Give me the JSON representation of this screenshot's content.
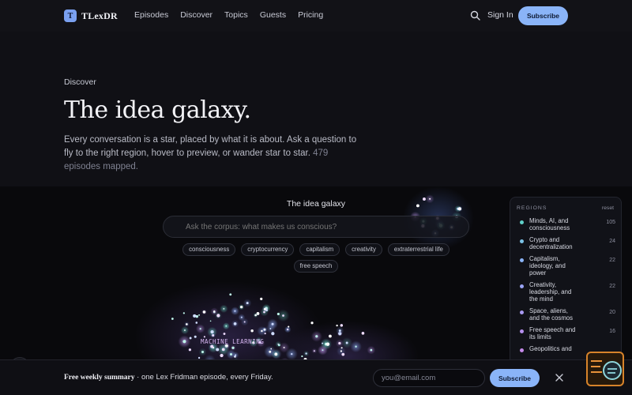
{
  "brand": {
    "logo_letter": "T",
    "name": "TLexDR"
  },
  "nav": {
    "items": [
      "Episodes",
      "Discover",
      "Topics",
      "Guests",
      "Pricing"
    ]
  },
  "header": {
    "search_icon": "search-icon",
    "signin": "Sign In",
    "subscribe": "Subscribe"
  },
  "hero": {
    "eyebrow": "Discover",
    "title": "The idea galaxy.",
    "lede": "Every conversation is a star, placed by what it is about. Ask a question to fly to the right region, hover to preview, or wander star to star.",
    "count_text": "479 episodes mapped."
  },
  "galaxy": {
    "title": "The idea galaxy",
    "search_placeholder": "Ask the corpus: what makes us conscious?",
    "chips": [
      "consciousness",
      "cryptocurrency",
      "capitalism",
      "creativity",
      "extraterrestrial life",
      "free speech"
    ],
    "cluster_label": "MACHINE LEARNING"
  },
  "regions": {
    "title": "REGIONS",
    "reset": "reset",
    "items": [
      {
        "name": "Minds, AI, and consciousness",
        "count": "105",
        "color": "#5fd0c8"
      },
      {
        "name": "Crypto and decentralization",
        "count": "24",
        "color": "#7cc3e6"
      },
      {
        "name": "Capitalism, ideology, and power",
        "count": "22",
        "color": "#8ab4f8"
      },
      {
        "name": "Creativity, leadership, and the mind",
        "count": "22",
        "color": "#9aa4f5"
      },
      {
        "name": "Space, aliens, and the cosmos",
        "count": "20",
        "color": "#a99af2"
      },
      {
        "name": "Free speech and its limits",
        "count": "16",
        "color": "#b690ee"
      },
      {
        "name": "Geopolitics and",
        "count": "",
        "color": "#c58aea"
      }
    ]
  },
  "banner": {
    "bold": "Free weekly summary",
    "text": " · one Lex Fridman episode, every Friday.",
    "email_placeholder": "you@email.com",
    "subscribe": "Subscribe",
    "close_icon": "close-icon"
  },
  "widget": {
    "icon": "assistant-icon"
  }
}
